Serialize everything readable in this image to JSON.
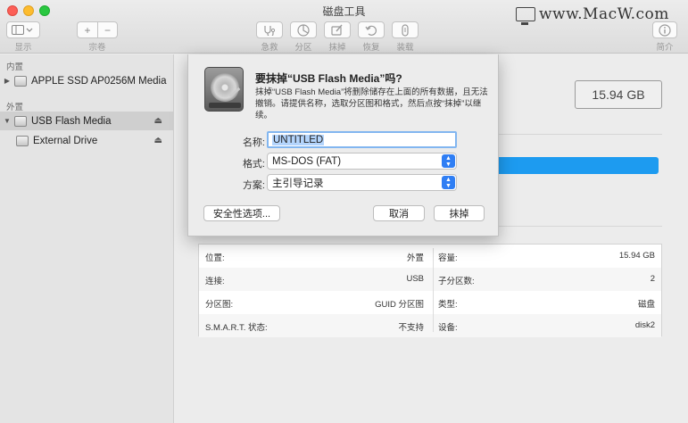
{
  "window": {
    "title": "磁盘工具"
  },
  "watermark": {
    "text": "www.MacW.com"
  },
  "toolbar": {
    "view_label": "显示",
    "volume_label": "宗卷",
    "volume_add": "+",
    "volume_remove": "−",
    "rescue_label": "急救",
    "partition_label": "分区",
    "erase_label": "抹掉",
    "restore_label": "恢复",
    "mount_label": "装载",
    "info_label": "简介"
  },
  "sidebar": {
    "internal_header": "内置",
    "external_header": "外置",
    "internal_items": [
      {
        "label": "APPLE SSD AP0256M Media"
      }
    ],
    "external_items": [
      {
        "label": "USB Flash Media",
        "eject": "⏏"
      },
      {
        "label": "External Drive",
        "eject": "⏏"
      }
    ]
  },
  "main": {
    "capacity_display": "15.94 GB",
    "info": [
      {
        "left_label": "位置:",
        "left_value": "外置",
        "right_label": "容量:",
        "right_value": "15.94 GB"
      },
      {
        "left_label": "连接:",
        "left_value": "USB",
        "right_label": "子分区数:",
        "right_value": "2"
      },
      {
        "left_label": "分区图:",
        "left_value": "GUID 分区图",
        "right_label": "类型:",
        "right_value": "磁盘"
      },
      {
        "left_label": "S.M.A.R.T. 状态:",
        "left_value": "不支持",
        "right_label": "设备:",
        "right_value": "disk2"
      }
    ]
  },
  "dialog": {
    "title": "要抹掉“USB Flash Media”吗?",
    "description": "抹掉“USB Flash Media”将删除储存在上面的所有数据，且无法撤销。请提供名称，选取分区图和格式，然后点按“抹掉”以继续。",
    "name_label": "名称:",
    "name_value": "UNTITLED",
    "format_label": "格式:",
    "format_value": "MS-DOS (FAT)",
    "scheme_label": "方案:",
    "scheme_value": "主引导记录",
    "security_button": "安全性选项...",
    "cancel_button": "取消",
    "erase_button": "抹掉"
  },
  "colors": {
    "accent": "#2f7ef4",
    "usage_bar": "#1d9bf0"
  }
}
